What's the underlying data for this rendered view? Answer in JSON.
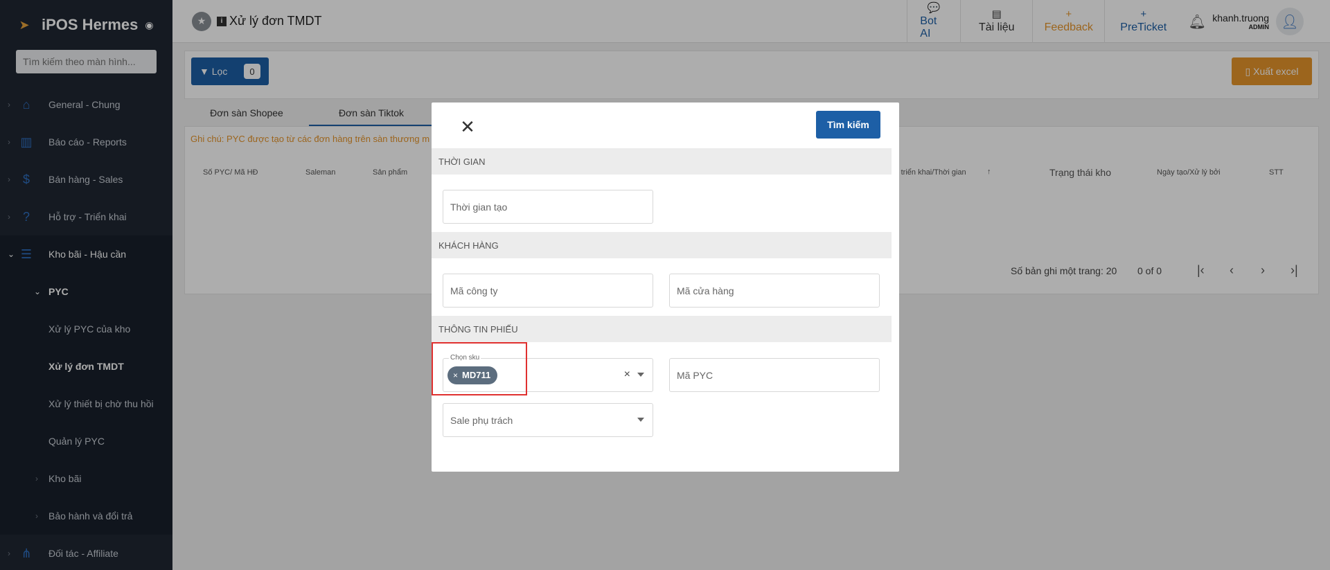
{
  "sidebar": {
    "brand": "iPOS Hermes",
    "search_placeholder": "Tìm kiếm theo màn hình...",
    "items": [
      {
        "label": "General - Chung",
        "icon": "home-icon"
      },
      {
        "label": "Báo cáo - Reports",
        "icon": "chart-icon"
      },
      {
        "label": "Bán hàng - Sales",
        "icon": "dollar-icon"
      },
      {
        "label": "Hỗ trợ - Triển khai",
        "icon": "help-icon"
      },
      {
        "label": "Kho bãi - Hậu cần",
        "icon": "warehouse-icon"
      }
    ],
    "sub_group": "PYC",
    "sub_items": [
      "Xử lý PYC của kho",
      "Xử lý đơn TMDT",
      "Xử lý thiết bị chờ thu hồi",
      "Quản lý PYC"
    ],
    "sub_groups2": [
      "Kho bãi",
      "Bảo hành và đổi trả"
    ],
    "last_item": {
      "label": "Đối tác - Affiliate",
      "icon": "affiliate-icon"
    }
  },
  "header": {
    "title": "Xử lý đơn TMDT",
    "bot": "Bot AI",
    "docs": "Tài liệu",
    "feedback": "Feedback",
    "preticket": "PreTicket",
    "user_name": "khanh.truong",
    "user_role": "ADMIN"
  },
  "toolbar": {
    "filter_label": "Lọc",
    "filter_count": "0",
    "export_label": "Xuất excel"
  },
  "tabs": [
    "Đơn sàn Shopee",
    "Đơn sàn Tiktok"
  ],
  "grid": {
    "note": "Ghi chú: PYC được tạo từ các đơn hàng trên sàn thương m",
    "columns": [
      "Số PYC/ Mã HĐ",
      "Saleman",
      "Sản phẩm",
      "ại triển khai/Thời gian",
      "Trạng thái kho",
      "Ngày tạo/Xử lý bởi",
      "STT"
    ],
    "per_page_label": "Số bản ghi một trang: 20",
    "range": "0 of 0"
  },
  "modal": {
    "search_button": "Tìm kiếm",
    "sections": [
      "THỜI GIAN",
      "KHÁCH HÀNG",
      "THÔNG TIN PHIẾU"
    ],
    "created_time": "Thời gian tạo",
    "company_code": "Mã công ty",
    "store_code": "Mã cửa hàng",
    "sku_legend": "Chọn sku",
    "sku_chip": "MD711",
    "pyc_code": "Mã PYC",
    "sale_owner": "Sale phụ trách"
  }
}
